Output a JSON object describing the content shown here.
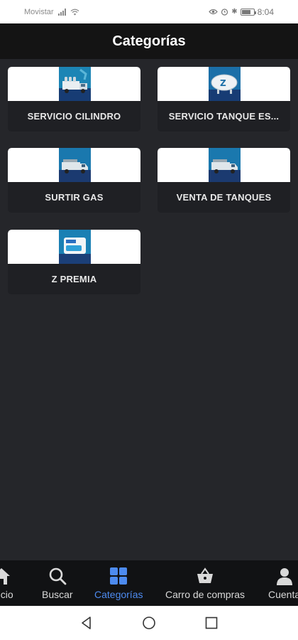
{
  "status_bar": {
    "carrier": "Movistar",
    "time": "8:04"
  },
  "header": {
    "title": "Categorías"
  },
  "categories": [
    {
      "label": "SERVICIO CILINDRO",
      "icon": "cylinder-truck-image"
    },
    {
      "label": "SERVICIO TANQUE ES...",
      "icon": "stationary-tank-image"
    },
    {
      "label": "SURTIR GAS",
      "icon": "gas-truck-image"
    },
    {
      "label": "VENTA DE TANQUES",
      "icon": "gas-truck-image"
    },
    {
      "label": "Z PREMIA",
      "icon": "zeta-card-image"
    }
  ],
  "bottom_nav": {
    "items": [
      {
        "label": "Inicio",
        "icon": "home-icon"
      },
      {
        "label": "Buscar",
        "icon": "search-icon"
      },
      {
        "label": "Categorías",
        "icon": "grid-icon",
        "active": true
      },
      {
        "label": "Carro de compras",
        "icon": "basket-icon"
      },
      {
        "label": "Cuenta",
        "icon": "user-icon"
      }
    ]
  },
  "colors": {
    "background": "#25262a",
    "header": "#141414",
    "card": "#1f2024",
    "accent": "#4d8bf0"
  }
}
